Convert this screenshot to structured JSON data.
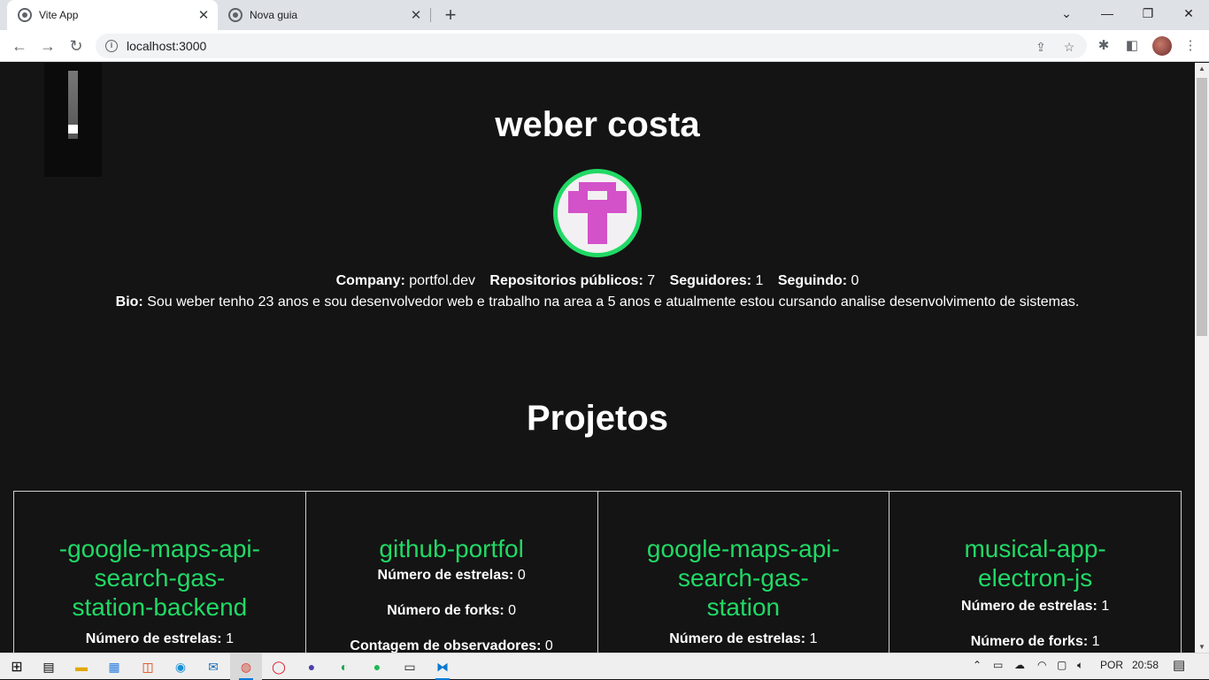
{
  "browser": {
    "tabs": [
      {
        "title": "Vite App",
        "active": true
      },
      {
        "title": "Nova guia",
        "active": false
      }
    ],
    "url": "localhost:3000"
  },
  "profile": {
    "name": "weber costa",
    "stats": [
      {
        "label": "Company:",
        "value": "portfol.dev"
      },
      {
        "label": "Repositorios públicos:",
        "value": "7"
      },
      {
        "label": "Seguidores:",
        "value": "1"
      },
      {
        "label": "Seguindo:",
        "value": "0"
      }
    ],
    "bio_label": "Bio:",
    "bio": "Sou weber tenho 23 anos e sou desenvolvedor web e trabalho na area a 5 anos e atualmente estou cursando analise desenvolvimento de sistemas."
  },
  "projects": {
    "title": "Projetos",
    "items": [
      {
        "name": "-google-maps-api-search-gas-station-backend",
        "name_lines": [
          "-google-maps-api-",
          "search-gas-",
          "station-backend"
        ],
        "stars_label": "Número de estrelas:",
        "stars": "1"
      },
      {
        "name": "github-portfol",
        "name_lines": [
          "github-portfol"
        ],
        "stars_label": "Número de estrelas:",
        "stars": "0",
        "forks_label": "Número de forks:",
        "forks": "0",
        "watchers_label": "Contagem de observadores:",
        "watchers": "0"
      },
      {
        "name": "google-maps-api-search-gas-station",
        "name_lines": [
          "google-maps-api-",
          "search-gas-",
          "station"
        ],
        "stars_label": "Número de estrelas:",
        "stars": "1"
      },
      {
        "name": "musical-app-electron-js",
        "name_lines": [
          "musical-app-",
          "electron-js"
        ],
        "stars_label": "Número de estrelas:",
        "stars": "1",
        "forks_label": "Número de forks:",
        "forks": "1"
      }
    ]
  },
  "taskbar": {
    "language": "POR",
    "time": "20:58"
  },
  "colors": {
    "accent": "#21d965",
    "page_bg": "#141414",
    "avatar_pixel": "#d351c9"
  }
}
